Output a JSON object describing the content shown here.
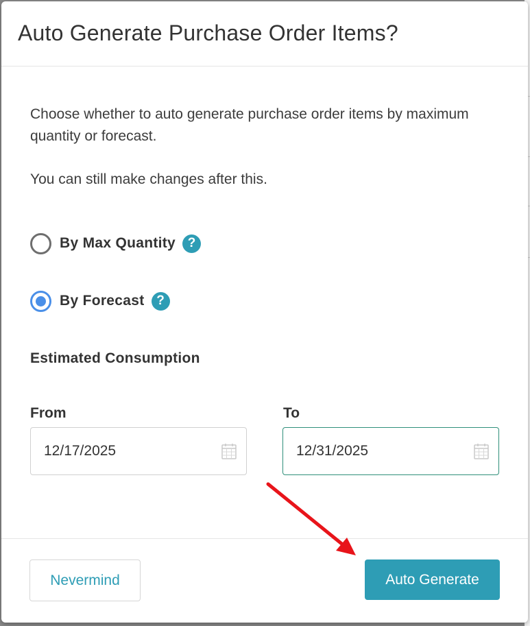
{
  "dialog": {
    "title": "Auto Generate Purchase Order Items?",
    "description": "Choose whether to auto generate purchase order items by maximum quantity or forecast.",
    "note": "You can still make changes after this.",
    "options": [
      {
        "label": "By Max Quantity",
        "selected": false,
        "help_icon": "question-circle-icon"
      },
      {
        "label": "By Forecast",
        "selected": true,
        "help_icon": "question-circle-icon"
      }
    ],
    "section_title": "Estimated Consumption",
    "from": {
      "label": "From",
      "value": "12/17/2025",
      "icon": "calendar-icon"
    },
    "to": {
      "label": "To",
      "value": "12/31/2025",
      "icon": "calendar-icon"
    },
    "help_glyph": "?",
    "buttons": {
      "cancel": "Nevermind",
      "confirm": "Auto Generate"
    }
  },
  "colors": {
    "accent": "#2e9db5",
    "radio_selected": "#4a8fe8",
    "annotation_arrow": "#e8141a"
  }
}
